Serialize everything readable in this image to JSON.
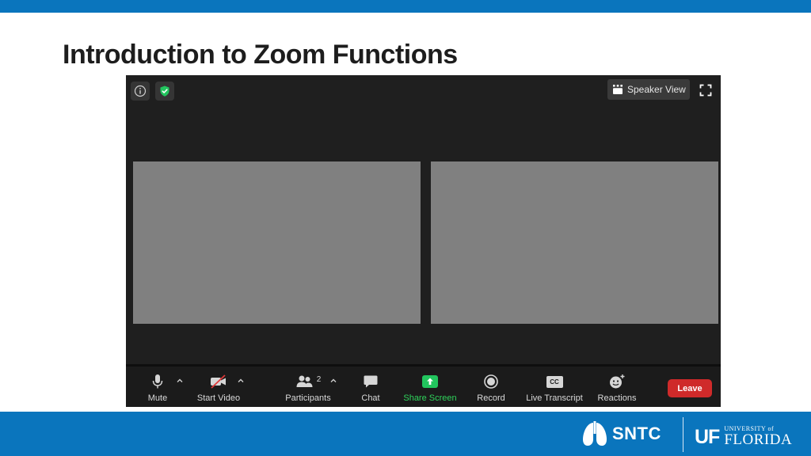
{
  "slide": {
    "title": "Introduction to Zoom Functions",
    "colors": {
      "band": "#0a75bd",
      "title": "#1d1d1d"
    }
  },
  "zoom": {
    "topbar": {
      "info_icon": "info-icon",
      "security_icon": "shield-check-icon",
      "speaker_view_label": "Speaker View",
      "fullscreen_icon": "fullscreen-icon"
    },
    "tiles": [
      "participant-video-1",
      "participant-video-2"
    ],
    "toolbar": {
      "mute": {
        "label": "Mute",
        "icon": "microphone-icon"
      },
      "start_video": {
        "label": "Start Video",
        "icon": "video-off-icon"
      },
      "participants": {
        "label": "Participants",
        "count": "2",
        "icon": "participants-icon"
      },
      "chat": {
        "label": "Chat",
        "icon": "chat-icon"
      },
      "share_screen": {
        "label": "Share Screen",
        "icon": "share-screen-icon",
        "color": "#2fd35b"
      },
      "record": {
        "label": "Record",
        "icon": "record-icon"
      },
      "live_transcript": {
        "label": "Live Transcript",
        "icon": "cc-icon",
        "icon_text": "CC"
      },
      "reactions": {
        "label": "Reactions",
        "icon": "reactions-icon"
      },
      "leave": {
        "label": "Leave",
        "color": "#cf2a2a"
      }
    }
  },
  "footer": {
    "sntc_label": "SNTC",
    "uf_mark": "UF",
    "uf_university": "UNIVERSITY of",
    "uf_florida": "FLORIDA"
  }
}
